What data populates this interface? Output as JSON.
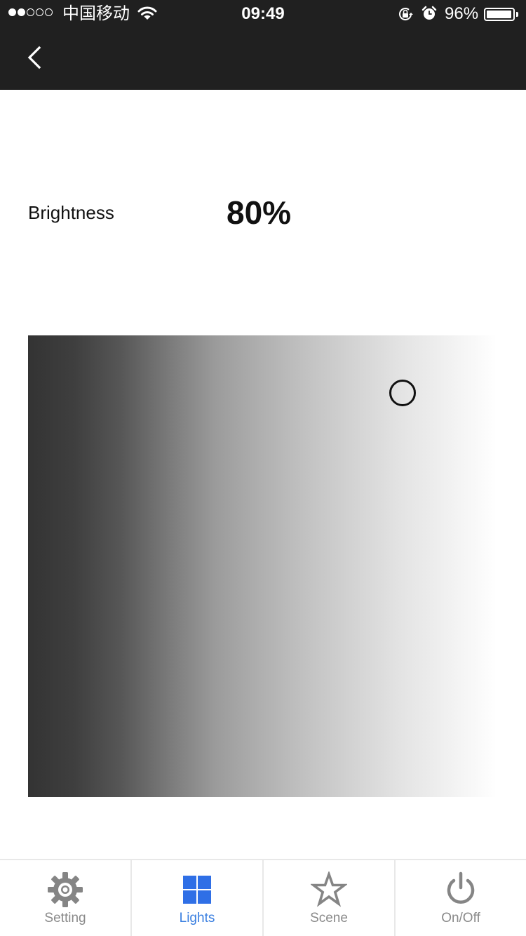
{
  "status_bar": {
    "signal_bars_filled": 2,
    "signal_bars_total": 5,
    "carrier": "中国移动",
    "time": "09:49",
    "battery_percent": "96%",
    "battery_level": 0.96,
    "icons": [
      "signal-dots",
      "wifi-icon",
      "rotation-lock-icon",
      "alarm-icon",
      "battery-icon"
    ]
  },
  "nav": {
    "back_icon": "chevron-left-icon"
  },
  "brightness": {
    "label": "Brightness",
    "value_text": "80%",
    "value": 80
  },
  "color_picker": {
    "type": "brightness-gradient",
    "gradient_start": "#333333",
    "gradient_end": "#ffffff",
    "selected_fraction_x": 0.8
  },
  "tabbar": {
    "active_color": "#3a7fe0",
    "inactive_color": "#8a8a8a",
    "tabs": [
      {
        "label": "Setting",
        "icon": "gear-icon",
        "active": false
      },
      {
        "label": "Lights",
        "icon": "grid-icon",
        "active": true
      },
      {
        "label": "Scene",
        "icon": "star-icon",
        "active": false
      },
      {
        "label": "On/Off",
        "icon": "power-icon",
        "active": false
      }
    ]
  }
}
